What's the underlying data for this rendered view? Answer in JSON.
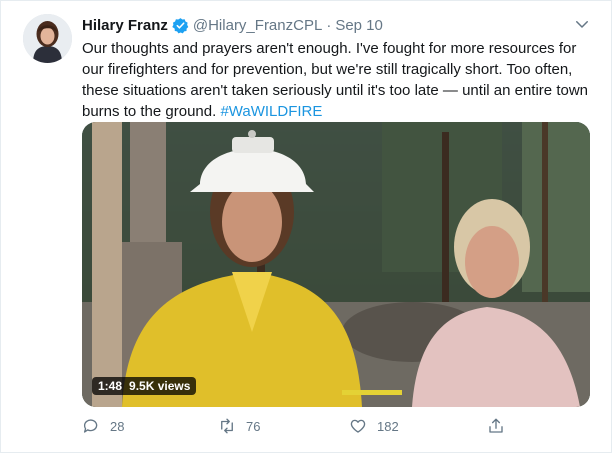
{
  "tweet": {
    "author_name": "Hilary Franz",
    "handle": "@Hilary_FranzCPL",
    "separator": "·",
    "date": "Sep 10",
    "text_main": "Our thoughts and prayers aren't enough. I've fought for more resources for our firefighters and for prevention, but we're still tragically short. Too often, these situations aren't taken seriously until it's too late — until an entire town burns to the ground. ",
    "hashtag": "#WaWILDFIRE",
    "video": {
      "duration": "1:48",
      "views": "9.5K views"
    },
    "actions": {
      "replies": "28",
      "retweets": "76",
      "likes": "182"
    },
    "colors": {
      "link": "#1b95e0",
      "verified": "#1da1f2",
      "muted": "#657786"
    },
    "icons": [
      "verified-badge-icon",
      "chevron-down-icon",
      "reply-icon",
      "retweet-icon",
      "like-icon",
      "share-icon"
    ]
  }
}
